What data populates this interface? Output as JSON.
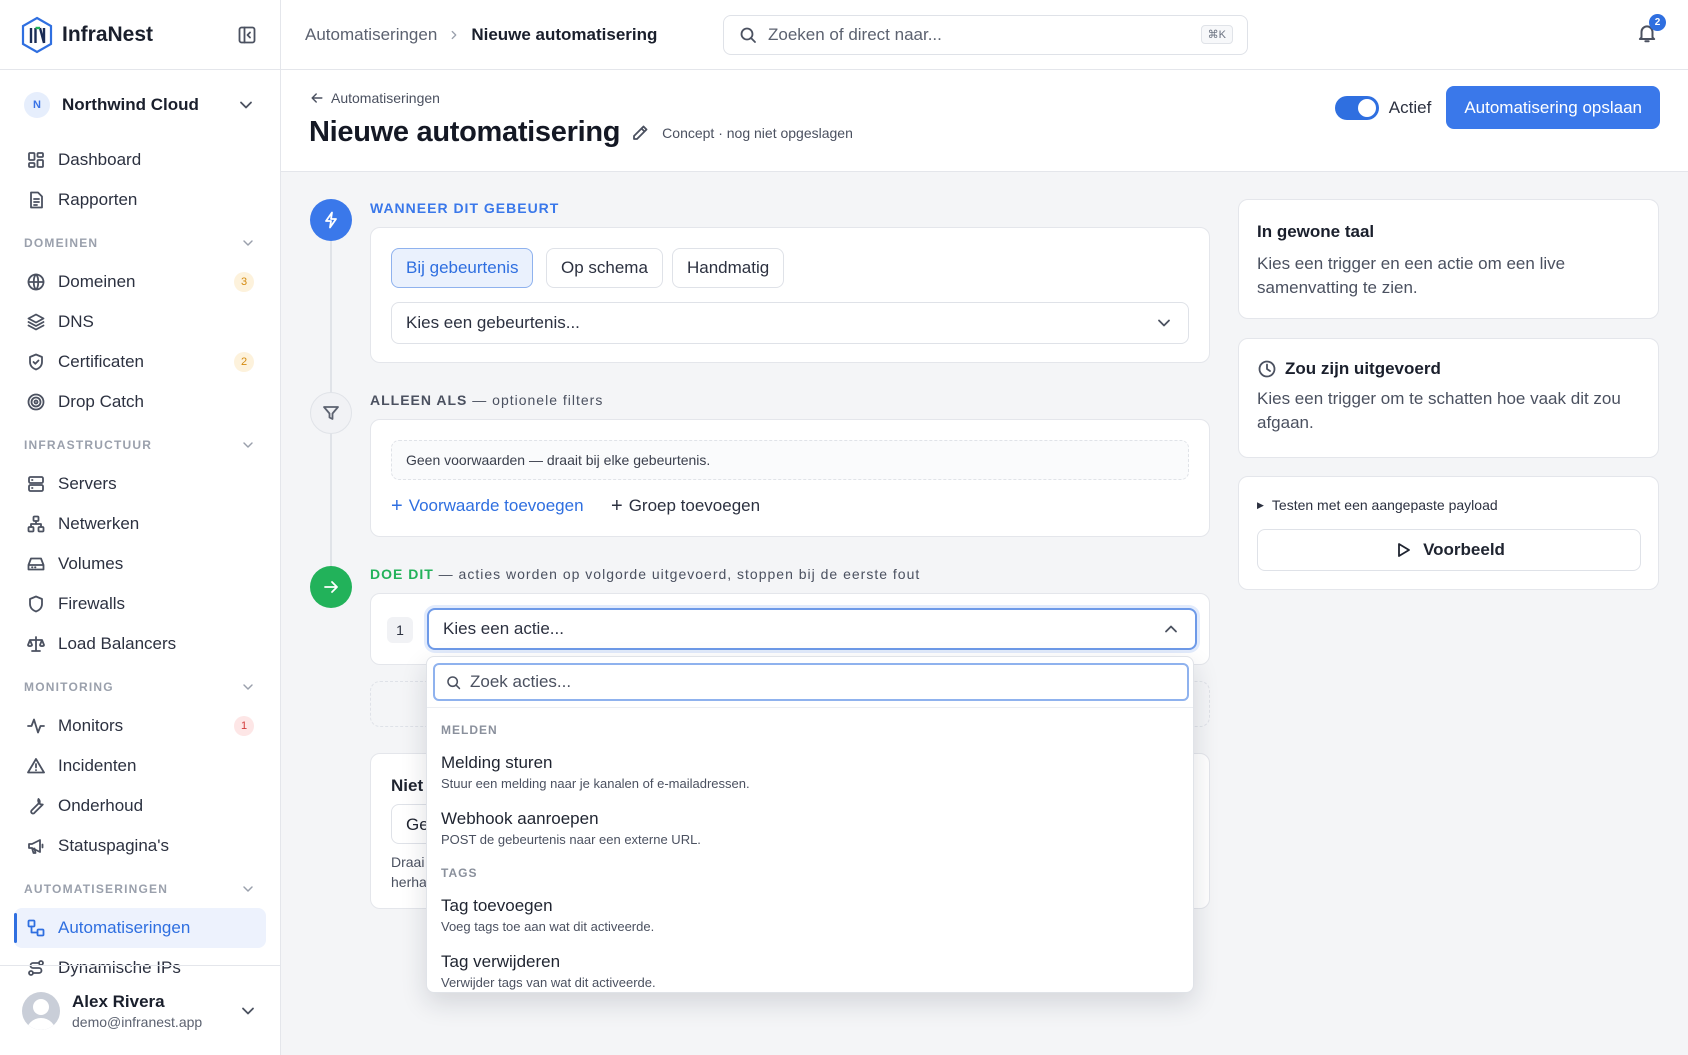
{
  "brand": {
    "name": "InfraNest"
  },
  "org": {
    "initial": "N",
    "name": "Northwind Cloud"
  },
  "nav": {
    "top": [
      {
        "label": "Dashboard",
        "icon": "dashboard-icon"
      },
      {
        "label": "Rapporten",
        "icon": "report-icon"
      }
    ],
    "sections": [
      {
        "title": "DOMEINEN",
        "items": [
          {
            "label": "Domeinen",
            "badge": "3",
            "badge_type": "warn"
          },
          {
            "label": "DNS"
          },
          {
            "label": "Certificaten",
            "badge": "2",
            "badge_type": "warn"
          },
          {
            "label": "Drop Catch"
          }
        ]
      },
      {
        "title": "INFRASTRUCTUUR",
        "items": [
          {
            "label": "Servers"
          },
          {
            "label": "Netwerken"
          },
          {
            "label": "Volumes"
          },
          {
            "label": "Firewalls"
          },
          {
            "label": "Load Balancers"
          }
        ]
      },
      {
        "title": "MONITORING",
        "items": [
          {
            "label": "Monitors",
            "badge": "1",
            "badge_type": "danger"
          },
          {
            "label": "Incidenten"
          },
          {
            "label": "Onderhoud"
          },
          {
            "label": "Statuspagina's"
          }
        ]
      },
      {
        "title": "AUTOMATISERINGEN",
        "items": [
          {
            "label": "Automatiseringen",
            "active": true
          },
          {
            "label": "Dynamische IPs"
          }
        ]
      }
    ]
  },
  "user": {
    "name": "Alex Rivera",
    "email": "demo@infranest.app"
  },
  "topbar": {
    "crumb_parent": "Automatiseringen",
    "crumb_current": "Nieuwe automatisering",
    "search_placeholder": "Zoeken of direct naar...",
    "search_shortcut": "⌘K",
    "notification_count": "2"
  },
  "header": {
    "back_label": "Automatiseringen",
    "title": "Nieuwe automatisering",
    "status": "Concept · nog niet opgeslagen",
    "toggle_label": "Actief",
    "save_label": "Automatisering opslaan"
  },
  "trigger": {
    "label": "WANNEER DIT GEBEURT",
    "tabs": [
      "Bij gebeurtenis",
      "Op schema",
      "Handmatig"
    ],
    "select_placeholder": "Kies een gebeurtenis..."
  },
  "filters": {
    "label": "ALLEEN ALS",
    "label_suffix": "— optionele filters",
    "empty": "Geen voorwaarden — draait bij elke gebeurtenis.",
    "add_condition": "Voorwaarde toevoegen",
    "add_group": "Groep toevoegen"
  },
  "actions": {
    "label": "DOE DIT",
    "label_suffix": "— acties worden op volgorde uitgevoerd, stoppen bij de eerste fout",
    "step_number": "1",
    "select_placeholder": "Kies een actie...",
    "hidden_card_title": "Niet",
    "hidden_card_field": "Ge",
    "hidden_card_note_1": "Draai",
    "hidden_card_note_2": "herha"
  },
  "dropdown": {
    "search_placeholder": "Zoek acties...",
    "groups": [
      {
        "title": "MELDEN",
        "items": [
          {
            "title": "Melding sturen",
            "desc": "Stuur een melding naar je kanalen of e-mailadressen."
          },
          {
            "title": "Webhook aanroepen",
            "desc": "POST de gebeurtenis naar een externe URL."
          }
        ]
      },
      {
        "title": "TAGS",
        "items": [
          {
            "title": "Tag toevoegen",
            "desc": "Voeg tags toe aan wat dit activeerde."
          },
          {
            "title": "Tag verwijderen",
            "desc": "Verwijder tags van wat dit activeerde."
          }
        ]
      }
    ]
  },
  "side": {
    "plain_title": "In gewone taal",
    "plain_desc": "Kies een trigger en een actie om een live samenvatting te zien.",
    "would_title": "Zou zijn uitgevoerd",
    "would_desc": "Kies een trigger om te schatten hoe vaak dit zou afgaan.",
    "test_label": "Testen met een aangepaste payload",
    "preview_label": "Voorbeeld"
  },
  "colors": {
    "accent": "#3a78ea",
    "trigger": "#3a78ea",
    "action": "#22b25a"
  }
}
